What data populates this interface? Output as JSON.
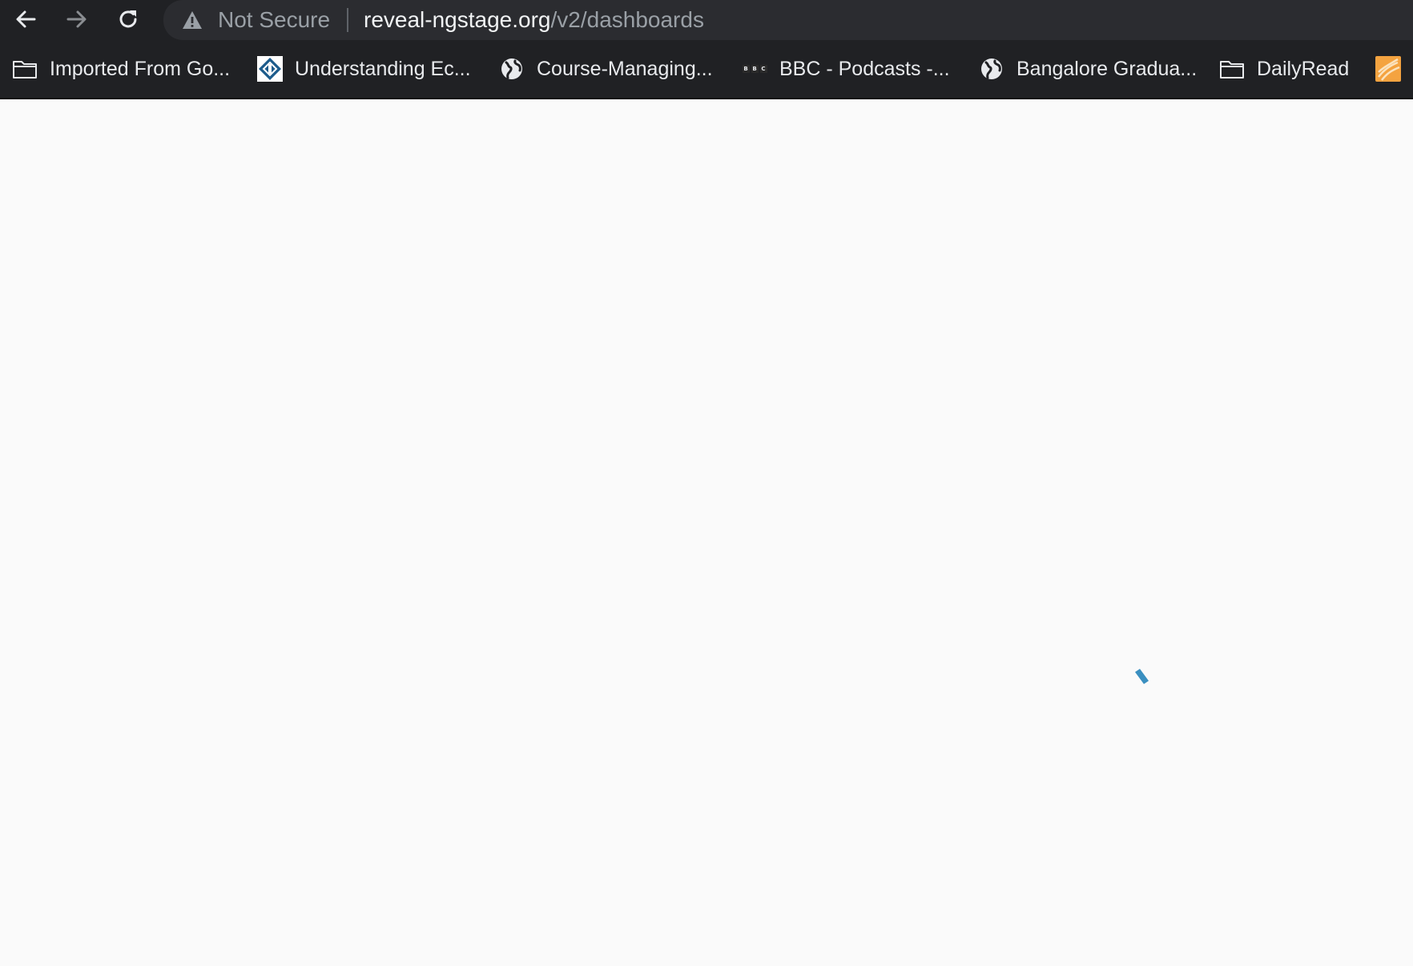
{
  "toolbar": {
    "back_icon": "arrow-left-icon",
    "forward_icon": "arrow-right-icon",
    "reload_icon": "reload-icon",
    "security_warning": "Not Secure",
    "url_host": "reveal-ngstage.org",
    "url_path": "/v2/dashboards"
  },
  "bookmarks": [
    {
      "label": "Imported From Go...",
      "icon": "folder-icon"
    },
    {
      "label": "Understanding Ec...",
      "icon": "site-logo-icon"
    },
    {
      "label": "Course-Managing...",
      "icon": "globe-icon"
    },
    {
      "label": "BBC - Podcasts -...",
      "icon": "bbc-logo-icon"
    },
    {
      "label": "Bangalore Gradua...",
      "icon": "globe-icon"
    },
    {
      "label": "DailyRead",
      "icon": "folder-icon"
    },
    {
      "label": "",
      "icon": "site-logo-icon"
    }
  ],
  "page": {
    "state": "loading",
    "spinner_color": "#3a8fc0"
  },
  "colors": {
    "chrome_bg": "#202124",
    "omnibox_bg": "#2b2c30",
    "page_bg": "#fafafa",
    "spinner": "#3a8fc0"
  }
}
